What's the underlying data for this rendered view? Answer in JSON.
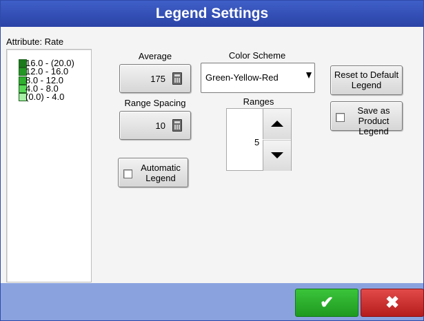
{
  "title": "Legend Settings",
  "attribute_label": "Attribute: Rate",
  "legend": [
    {
      "label": "16.0 - (20.0)",
      "color": "#1b7a1b"
    },
    {
      "label": "12.0 - 16.0",
      "color": "#239623"
    },
    {
      "label": "8.0 - 12.0",
      "color": "#2fb12f"
    },
    {
      "label": "4.0 - 8.0",
      "color": "#56d856"
    },
    {
      "label": "(0.0) - 4.0",
      "color": "#a6f0a6"
    }
  ],
  "average": {
    "label": "Average",
    "value": "175",
    "icon": "calculator-icon"
  },
  "range_spacing": {
    "label": "Range Spacing",
    "value": "10",
    "icon": "calculator-icon"
  },
  "color_scheme": {
    "label": "Color Scheme",
    "selected": "Green-Yellow-Red",
    "icon": "dropdown-arrow-icon"
  },
  "ranges": {
    "label": "Ranges",
    "value": "5",
    "up_icon": "up-arrow-icon",
    "down_icon": "down-arrow-icon"
  },
  "automatic_legend": {
    "label_line1": "Automatic",
    "label_line2": "Legend",
    "checked": false
  },
  "reset_button": {
    "line1": "Reset to Default",
    "line2": "Legend"
  },
  "save_product": {
    "line1": "Save as Product",
    "line2": "Legend",
    "checked": false
  },
  "ok_button": {
    "glyph": "✔",
    "icon": "checkmark-icon",
    "color": "#2db02d"
  },
  "cancel_button": {
    "glyph": "✖",
    "icon": "close-icon",
    "color": "#d12f2f"
  },
  "colors": {
    "titlebar": "#3452b6",
    "footer": "#8aa3df"
  }
}
